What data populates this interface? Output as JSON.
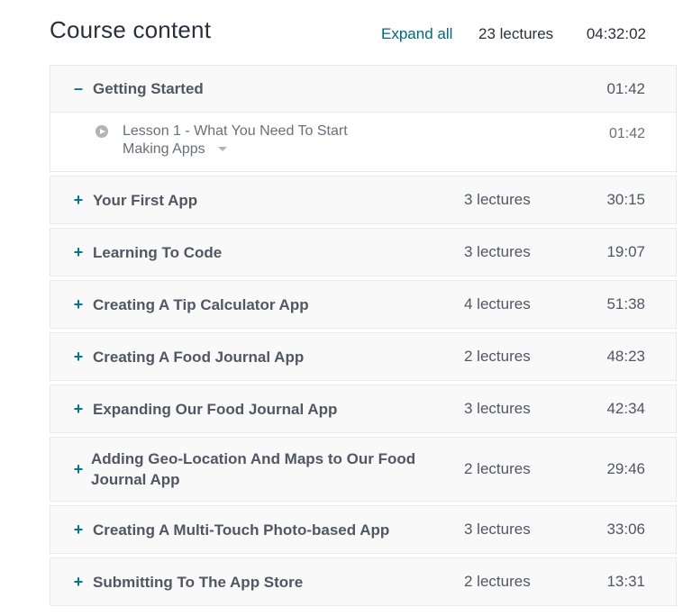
{
  "header": {
    "title": "Course content",
    "expand_all": "Expand all",
    "total_lectures": "23 lectures",
    "total_time": "04:32:02"
  },
  "sections": [
    {
      "toggle": "–",
      "title": "Getting Started",
      "lectures": "",
      "time": "01:42",
      "expanded": true,
      "lessons": [
        {
          "title": "Lesson 1 - What You Need To Start Making Apps",
          "time": "01:42"
        }
      ]
    },
    {
      "toggle": "+",
      "title": "Your First App",
      "lectures": "3 lectures",
      "time": "30:15"
    },
    {
      "toggle": "+",
      "title": "Learning To Code",
      "lectures": "3 lectures",
      "time": "19:07"
    },
    {
      "toggle": "+",
      "title": "Creating A Tip Calculator App",
      "lectures": "4 lectures",
      "time": "51:38"
    },
    {
      "toggle": "+",
      "title": "Creating A Food Journal App",
      "lectures": "2 lectures",
      "time": "48:23"
    },
    {
      "toggle": "+",
      "title": "Expanding Our Food Journal App",
      "lectures": "3 lectures",
      "time": "42:34"
    },
    {
      "toggle": "+",
      "title": "Adding Geo-Location And Maps to Our Food Journal App",
      "lectures": "2 lectures",
      "time": "29:46"
    },
    {
      "toggle": "+",
      "title": "Creating A Multi-Touch Photo-based App",
      "lectures": "3 lectures",
      "time": "33:06"
    },
    {
      "toggle": "+",
      "title": "Submitting To The App Store",
      "lectures": "2 lectures",
      "time": "13:31"
    }
  ],
  "colors": {
    "accent": "#007791",
    "text": "#29303b",
    "muted": "#505763",
    "border": "#e8e9eb",
    "row_bg": "#f9f9f9"
  }
}
